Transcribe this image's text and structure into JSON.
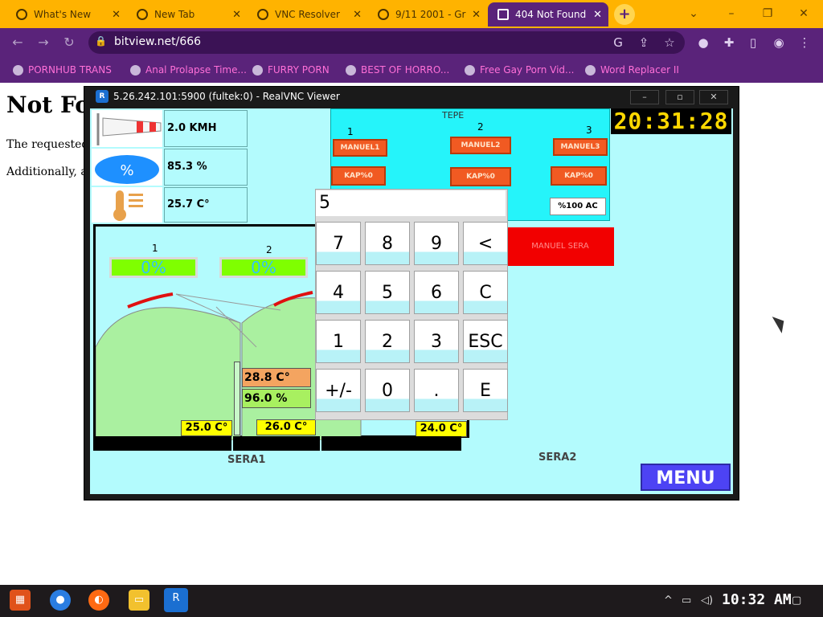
{
  "browser": {
    "tabs": [
      {
        "label": "What's New",
        "icon": "chrome-icon"
      },
      {
        "label": "New Tab",
        "icon": "chrome-icon"
      },
      {
        "label": "VNC Resolver",
        "icon": "vnc-icon"
      },
      {
        "label": "9/11 2001 - Gr",
        "icon": "google-icon"
      },
      {
        "label": "404 Not Found",
        "icon": "bitview-icon",
        "active": true
      }
    ],
    "close_glyph": "✕",
    "new_tab_glyph": "+",
    "url": "bitview.net/666",
    "bookmarks": [
      "PORNHUB TRANS",
      "Anal Prolapse Time...",
      "FURRY PORN",
      "BEST OF HORRO...",
      "Free Gay Porn Vid...",
      "Word Replacer II"
    ]
  },
  "page": {
    "heading": "Not Fo",
    "line1": "The requested U",
    "line2": "Additionally, a"
  },
  "vnc": {
    "title": "5.26.242.101:5900 (fultek:0) - RealVNC Viewer",
    "icon_text": "R",
    "controls": [
      "–",
      "▫",
      "✕"
    ]
  },
  "hmi": {
    "wind": "2.0 KMH",
    "humidity": "85.3 %",
    "temperature": "25.7 C°",
    "humidity_icon_text": "%",
    "tepe_title": "TEPE",
    "tepe_columns": [
      "1",
      "2",
      "3"
    ],
    "manuel_labels": [
      "MANUEL1",
      "MANUEL2",
      "MANUEL3"
    ],
    "kap_labels": [
      "KAP%0",
      "KAP%0",
      "KAP%0"
    ],
    "ac_label": "%100 AC",
    "clock": "20:31:28",
    "red_button_label": "MANUEL SERA",
    "sera_numbers": [
      "1",
      "2"
    ],
    "sera_percents": [
      "0%",
      "0%"
    ],
    "inner_temp": "28.8 C°",
    "inner_humidity": "96.0 %",
    "temps": [
      "25.0 C°",
      "26.0 C°",
      "24.0 C°"
    ],
    "sera1_label": "SERA1",
    "sera2_label": "SERA2",
    "menu_label": "MENU"
  },
  "keypad": {
    "display_value": "5",
    "keys": [
      "7",
      "8",
      "9",
      "<",
      "4",
      "5",
      "6",
      "C",
      "1",
      "2",
      "3",
      "ESC",
      "+/-",
      "0",
      ".",
      "E"
    ]
  },
  "taskbar": {
    "clock": "10:32 AM",
    "apps": [
      "start",
      "chrome",
      "firefox",
      "explorer",
      "realvnc"
    ]
  }
}
